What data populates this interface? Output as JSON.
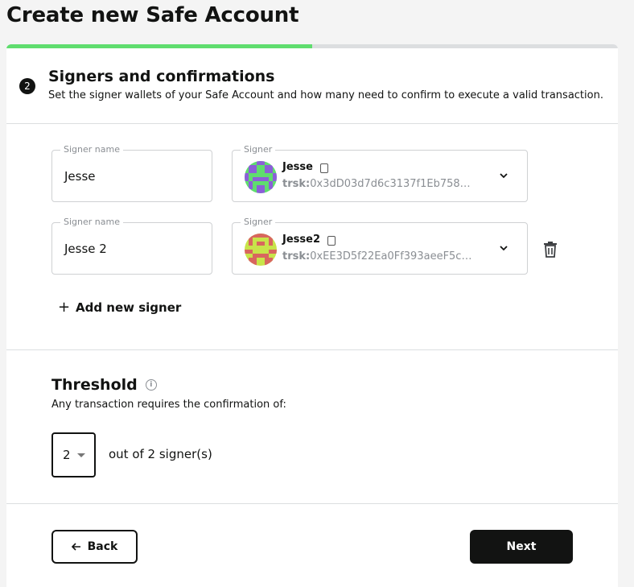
{
  "page_title": "Create new Safe Account",
  "progress": {
    "fraction": 0.5,
    "color": "#5fdd6e"
  },
  "step": {
    "number": "2",
    "title": "Signers and confirmations",
    "subtitle": "Set the signer wallets of your Safe Account and how many need to confirm to execute a valid transaction."
  },
  "signers": [
    {
      "name_label": "Signer name",
      "name_value": "Jesse",
      "signer_label": "Signer",
      "wallet_name": "Jesse",
      "address_prefix": "trsk:",
      "address": "0x3dD03d7d6c3137f1Eb7582b…"
    },
    {
      "name_label": "Signer name",
      "name_value": "Jesse 2",
      "signer_label": "Signer",
      "wallet_name": "Jesse2",
      "address_prefix": "trsk:",
      "address": "0xEE3D5f22Ea0Ff393aeeF5cf8…"
    }
  ],
  "add_signer_label": "Add new signer",
  "threshold": {
    "title": "Threshold",
    "subtitle": "Any transaction requires the confirmation of:",
    "selected": "2",
    "suffix": "out of 2 signer(s)"
  },
  "buttons": {
    "back": "Back",
    "next": "Next"
  },
  "icons": {
    "copy": "copy-icon",
    "chevron": "chevron-down-icon",
    "trash": "trash-icon",
    "plus": "plus-icon",
    "info": "info-icon",
    "arrow_back": "arrow-left-icon"
  }
}
